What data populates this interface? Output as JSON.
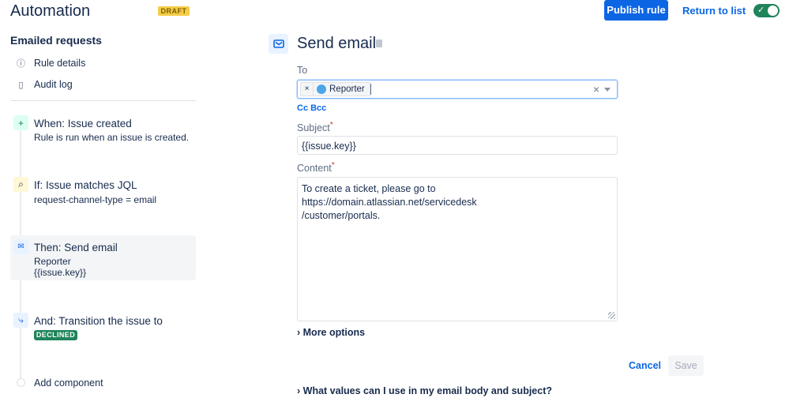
{
  "header": {
    "title": "Automation",
    "badge": "DRAFT",
    "publish": "Publish rule",
    "return": "Return to list",
    "enabled": true
  },
  "sidebar": {
    "rule_name": "Emailed requests",
    "nav": [
      {
        "label": "Rule details",
        "icon": "info-icon"
      },
      {
        "label": "Audit log",
        "icon": "document-icon"
      }
    ],
    "steps": [
      {
        "title": "When: Issue created",
        "lines": [
          "Rule is run when an issue is created."
        ]
      },
      {
        "title": "If: Issue matches JQL",
        "lines": [
          "request-channel-type = email"
        ]
      },
      {
        "title": "Then: Send email",
        "lines": [
          "Reporter",
          "{{issue.key}}"
        ]
      },
      {
        "title": "And: Transition the issue to",
        "badge": "DECLINED"
      }
    ],
    "add": "Add component"
  },
  "panel": {
    "title": "Send email",
    "to_label": "To",
    "to_chip": "Reporter",
    "ccbcc": "Cc Bcc",
    "subject_label": "Subject",
    "subject_value": "{{issue.key}}",
    "content_label": "Content",
    "content_value": "To create a ticket, please go to https://domain.atlassian.net/servicedesk\n/customer/portals.",
    "more": "More options",
    "cancel": "Cancel",
    "save": "Save",
    "help": "What values can I use in my email body and subject?",
    "required": "*"
  }
}
